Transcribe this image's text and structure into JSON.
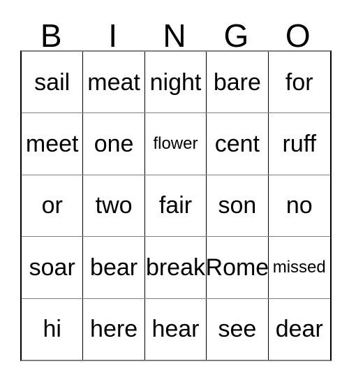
{
  "card": {
    "header": {
      "letters": [
        "B",
        "I",
        "N",
        "G",
        "O"
      ]
    },
    "rows": [
      [
        {
          "text": "sail",
          "size": "normal"
        },
        {
          "text": "meat",
          "size": "normal"
        },
        {
          "text": "night",
          "size": "normal"
        },
        {
          "text": "bare",
          "size": "normal"
        },
        {
          "text": "for",
          "size": "normal"
        }
      ],
      [
        {
          "text": "meet",
          "size": "normal"
        },
        {
          "text": "one",
          "size": "normal"
        },
        {
          "text": "flower",
          "size": "small"
        },
        {
          "text": "cent",
          "size": "normal"
        },
        {
          "text": "ruff",
          "size": "normal"
        }
      ],
      [
        {
          "text": "or",
          "size": "normal"
        },
        {
          "text": "two",
          "size": "normal"
        },
        {
          "text": "fair",
          "size": "normal"
        },
        {
          "text": "son",
          "size": "normal"
        },
        {
          "text": "no",
          "size": "normal"
        }
      ],
      [
        {
          "text": "soar",
          "size": "normal"
        },
        {
          "text": "bear",
          "size": "normal"
        },
        {
          "text": "break",
          "size": "normal"
        },
        {
          "text": "Rome",
          "size": "normal"
        },
        {
          "text": "missed",
          "size": "small"
        }
      ],
      [
        {
          "text": "hi",
          "size": "normal"
        },
        {
          "text": "here",
          "size": "normal"
        },
        {
          "text": "hear",
          "size": "normal"
        },
        {
          "text": "see",
          "size": "normal"
        },
        {
          "text": "dear",
          "size": "normal"
        }
      ]
    ],
    "colors": {
      "background": "#ffffff",
      "text": "#000000",
      "horizontal_border": "#808080",
      "vertical_border": "#000000"
    }
  }
}
